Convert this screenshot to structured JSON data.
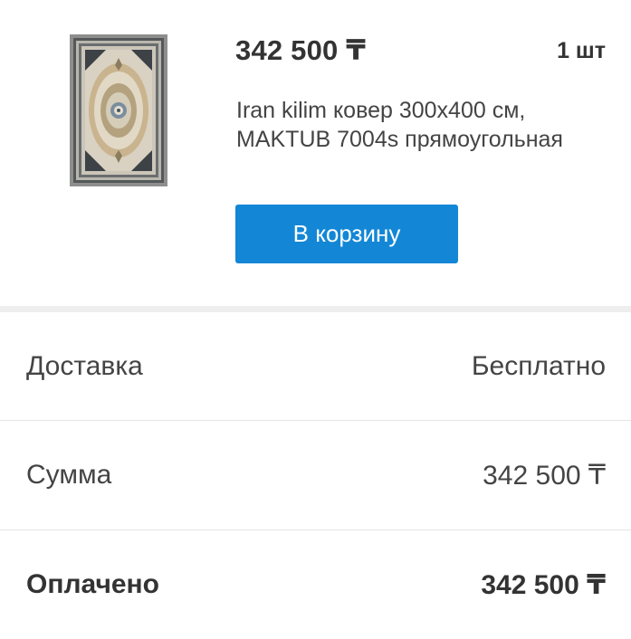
{
  "product": {
    "price": "342 500 ₸",
    "quantity": "1 шт",
    "title": "Iran kilim ковер 300x400 см, MAKTUB 7004s прямоугольная",
    "image_icon": "rug-product-image",
    "cart_button_label": "В корзину",
    "cart_button_color": "#1387d6"
  },
  "summary": {
    "delivery_label": "Доставка",
    "delivery_value": "Бесплатно",
    "sum_label": "Сумма",
    "sum_value": "342 500 ₸",
    "paid_label": "Оплачено",
    "paid_value": "342 500 ₸"
  }
}
